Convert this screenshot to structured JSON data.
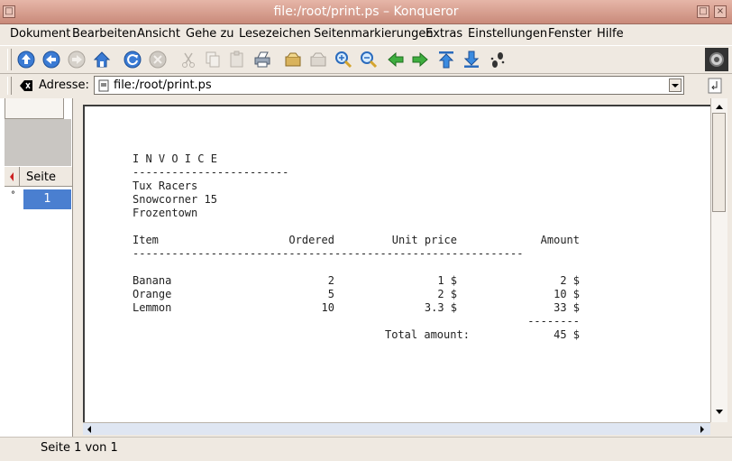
{
  "window": {
    "title": "file:/root/print.ps – Konqueror"
  },
  "menu": {
    "items": [
      "Dokument",
      "Bearbeiten",
      "Ansicht",
      "Gehe zu",
      "Lesezeichen",
      "Seitenmarkierungen",
      "Extras",
      "Einstellungen",
      "Fenster",
      "Hilfe"
    ]
  },
  "address": {
    "label": "Adresse:",
    "value": "file:/root/print.ps"
  },
  "sidebar": {
    "header": "Seite",
    "selected_page": "1"
  },
  "document": {
    "title": "I N V O I C E",
    "title_rule": "------------------------",
    "address_lines": [
      "Tux Racers",
      "Snowcorner 15",
      "Frozentown"
    ],
    "columns": [
      "Item",
      "Ordered",
      "Unit price",
      "Amount"
    ],
    "header_rule": "------------------------------------------------------------",
    "rows": [
      {
        "item": "Banana",
        "ordered": "2",
        "unit_price": "1 $",
        "amount": "2 $"
      },
      {
        "item": "Orange",
        "ordered": "5",
        "unit_price": "2 $",
        "amount": "10 $"
      },
      {
        "item": "Lemmon",
        "ordered": "10",
        "unit_price": "3.3 $",
        "amount": "33 $"
      }
    ],
    "sum_rule": "--------",
    "total_label": "Total amount:",
    "total_value": "45 $"
  },
  "status": {
    "text": "Seite 1 von 1"
  }
}
